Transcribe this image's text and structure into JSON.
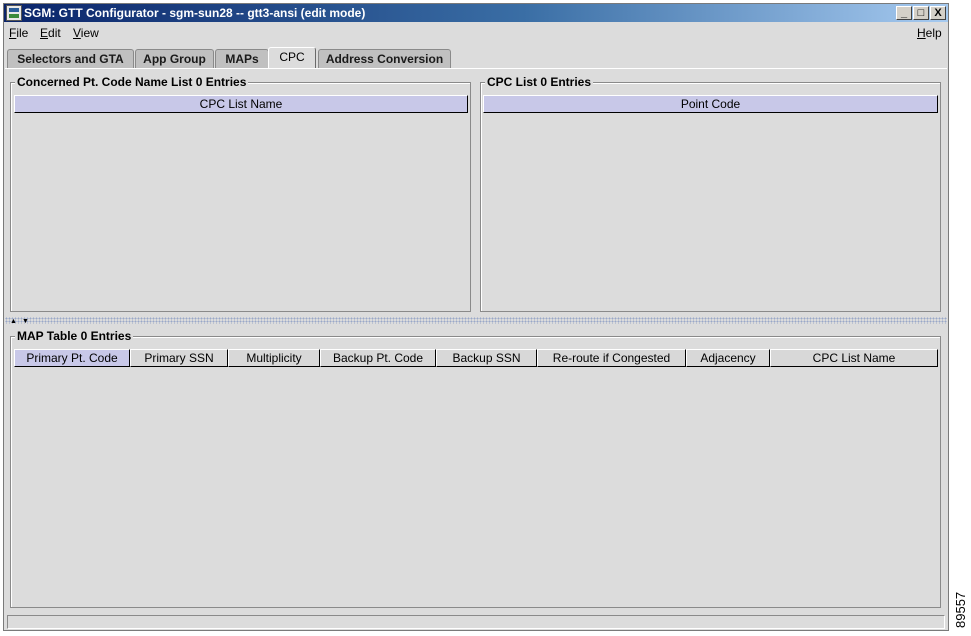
{
  "window": {
    "title": "SGM:  GTT Configurator - sgm-sun28 -- gtt3-ansi (edit mode)",
    "minimize_glyph": "_",
    "maximize_glyph": "□",
    "close_glyph": "X"
  },
  "menu": {
    "file": {
      "mnemonic": "F",
      "rest": "ile"
    },
    "edit": {
      "mnemonic": "E",
      "rest": "dit"
    },
    "view": {
      "mnemonic": "V",
      "rest": "iew"
    },
    "help": {
      "mnemonic": "H",
      "rest": "elp"
    }
  },
  "tabs": [
    {
      "label": "Selectors and GTA",
      "active": false
    },
    {
      "label": "App Group",
      "active": false
    },
    {
      "label": "MAPs",
      "active": false
    },
    {
      "label": "CPC",
      "active": true
    },
    {
      "label": "Address Conversion",
      "active": false
    }
  ],
  "cpc_name_list": {
    "title": "Concerned Pt. Code Name List   0 Entries",
    "columns": [
      "CPC List Name"
    ]
  },
  "cpc_list": {
    "title": "CPC List   0 Entries",
    "columns": [
      "Point Code"
    ]
  },
  "map_table": {
    "title": "MAP Table   0 Entries",
    "columns": [
      "Primary Pt. Code",
      "Primary SSN",
      "Multiplicity",
      "Backup Pt. Code",
      "Backup SSN",
      "Re-route if Congested",
      "Adjacency",
      "CPC List Name"
    ]
  },
  "splitter": {
    "up_arrow": "▲",
    "down_arrow": "▼"
  },
  "figure_number": "89557",
  "icons": {
    "app": "app-icon",
    "minimize": "minimize-icon",
    "maximize": "maximize-icon",
    "close": "close-icon"
  }
}
